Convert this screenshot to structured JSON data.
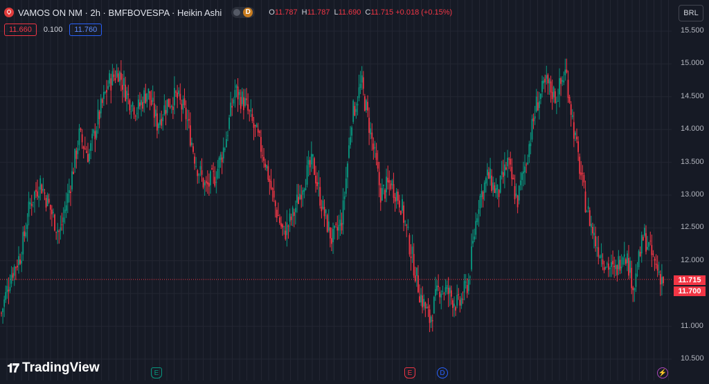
{
  "header": {
    "title": "VAMOS ON NM · 2h · BMFBOVESPA · Heikin Ashi",
    "delay_badge": "D",
    "ohlc": [
      {
        "key": "O",
        "value": "11.787"
      },
      {
        "key": "H",
        "value": "11.787"
      },
      {
        "key": "L",
        "value": "11.690"
      },
      {
        "key": "C",
        "value": "11.715"
      },
      {
        "key": "",
        "value": "+0.018 (+0.15%)"
      }
    ]
  },
  "order_panel": {
    "sell_price": "11.660",
    "spread": "0.100",
    "buy_price": "11.760"
  },
  "currency": "BRL",
  "price_axis": {
    "ticks": [
      "15.500",
      "15.000",
      "14.500",
      "14.000",
      "13.500",
      "13.000",
      "12.500",
      "12.000",
      "11.500",
      "11.000",
      "10.500"
    ],
    "last_price": "11.715",
    "bid_tag": "11.700"
  },
  "watermark": "TradingView",
  "events": [
    {
      "label": "E",
      "color": "#089981",
      "type": "earnings"
    },
    {
      "label": "E",
      "color": "#f23645",
      "type": "earnings"
    },
    {
      "label": "D",
      "color": "#2962ff",
      "type": "dividend"
    },
    {
      "label": "⚡",
      "color": "#ab47bc",
      "type": "split"
    }
  ],
  "colors": {
    "up": "#089981",
    "down": "#f23645",
    "background": "#161a25",
    "grid": "#232632"
  },
  "chart_data": {
    "type": "candlestick",
    "style": "Heikin Ashi",
    "ylim": [
      10.5,
      15.5
    ],
    "y_ticks": [
      10.5,
      11.0,
      11.5,
      12.0,
      12.5,
      13.0,
      13.5,
      14.0,
      14.5,
      15.0,
      15.5
    ],
    "last_price": 11.715,
    "grid": true,
    "path": [
      11.2,
      11.8,
      12.1,
      12.9,
      13.2,
      12.8,
      12.4,
      13.1,
      13.9,
      13.6,
      14.2,
      14.7,
      14.9,
      14.5,
      14.3,
      14.6,
      14.1,
      14.4,
      14.5,
      14.2,
      13.5,
      13.1,
      13.3,
      13.8,
      14.6,
      14.4,
      14.0,
      13.6,
      12.9,
      12.4,
      12.7,
      13.2,
      13.5,
      12.8,
      12.3,
      12.6,
      14.2,
      14.7,
      13.9,
      13.0,
      13.2,
      12.9,
      12.2,
      11.5,
      11.1,
      11.6,
      11.5,
      11.3,
      11.7,
      12.9,
      13.3,
      13.0,
      13.5,
      12.9,
      13.6,
      14.4,
      14.7,
      14.5,
      14.9,
      13.8,
      12.9,
      12.3,
      12.0,
      11.8,
      12.2,
      11.6,
      12.4,
      12.0,
      11.7
    ],
    "n_candles": 460
  }
}
